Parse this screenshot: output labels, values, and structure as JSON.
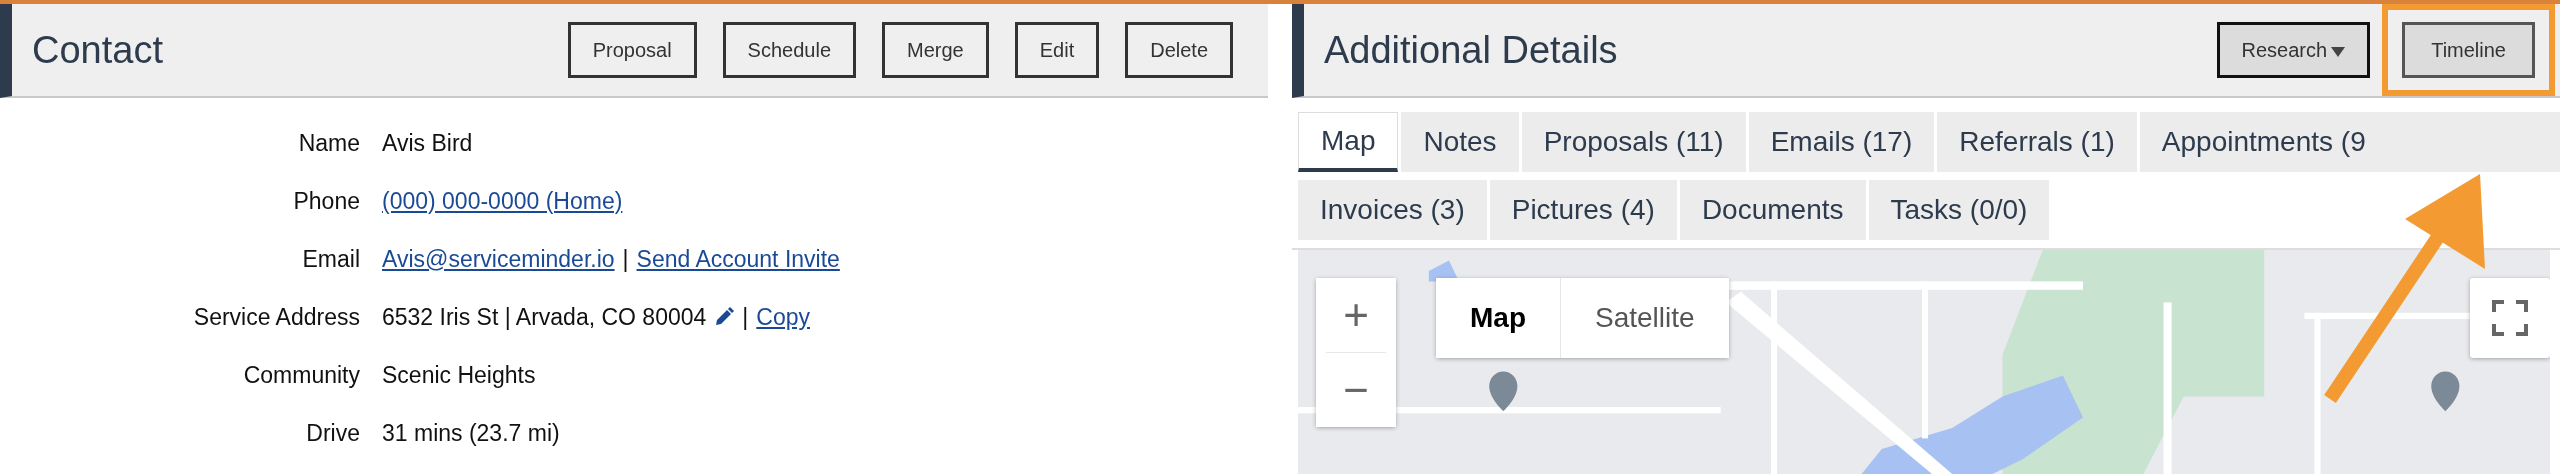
{
  "contact": {
    "title": "Contact",
    "buttons": [
      "Proposal",
      "Schedule",
      "Merge",
      "Edit",
      "Delete"
    ],
    "fields": [
      {
        "label": "Name",
        "parts": [
          {
            "kind": "text",
            "text": "Avis Bird"
          }
        ]
      },
      {
        "label": "Phone",
        "parts": [
          {
            "kind": "link",
            "text": "(000) 000-0000 (Home)"
          }
        ]
      },
      {
        "label": "Email",
        "parts": [
          {
            "kind": "link",
            "text": "Avis@serviceminder.io"
          },
          {
            "kind": "text",
            "text": "|"
          },
          {
            "kind": "link",
            "text": "Send Account Invite"
          }
        ]
      },
      {
        "label": "Service Address",
        "parts": [
          {
            "kind": "text",
            "text": "6532 Iris St | Arvada, CO 80004"
          },
          {
            "kind": "edit"
          },
          {
            "kind": "text",
            "text": "|"
          },
          {
            "kind": "link",
            "text": "Copy"
          }
        ]
      },
      {
        "label": "Community",
        "parts": [
          {
            "kind": "text",
            "text": "Scenic Heights"
          }
        ]
      },
      {
        "label": "Drive",
        "parts": [
          {
            "kind": "text",
            "text": "31 mins (23.7 mi)"
          }
        ]
      }
    ]
  },
  "additional_details": {
    "title": "Additional Details",
    "buttons": [
      {
        "label": "Research",
        "kind": "dropdown",
        "highlighted": false
      },
      {
        "label": "Timeline",
        "kind": "plain",
        "highlighted": true
      }
    ],
    "tab_rows": [
      [
        {
          "label": "Map",
          "selected": true
        },
        {
          "label": "Notes",
          "selected": false
        },
        {
          "label": "Proposals (11)",
          "selected": false
        },
        {
          "label": "Emails (17)",
          "selected": false
        },
        {
          "label": "Referrals (1)",
          "selected": false
        },
        {
          "label": "Appointments (9",
          "selected": false
        }
      ],
      [
        {
          "label": "Invoices (3)",
          "selected": false
        },
        {
          "label": "Pictures (4)",
          "selected": false
        },
        {
          "label": "Documents",
          "selected": false
        },
        {
          "label": "Tasks (0/0)",
          "selected": false
        }
      ]
    ],
    "map": {
      "kind": "picture",
      "zoom_in": "+",
      "zoom_out": "−",
      "map_types": [
        {
          "label": "Map",
          "selected": true
        },
        {
          "label": "Satellite",
          "selected": false
        }
      ]
    }
  }
}
